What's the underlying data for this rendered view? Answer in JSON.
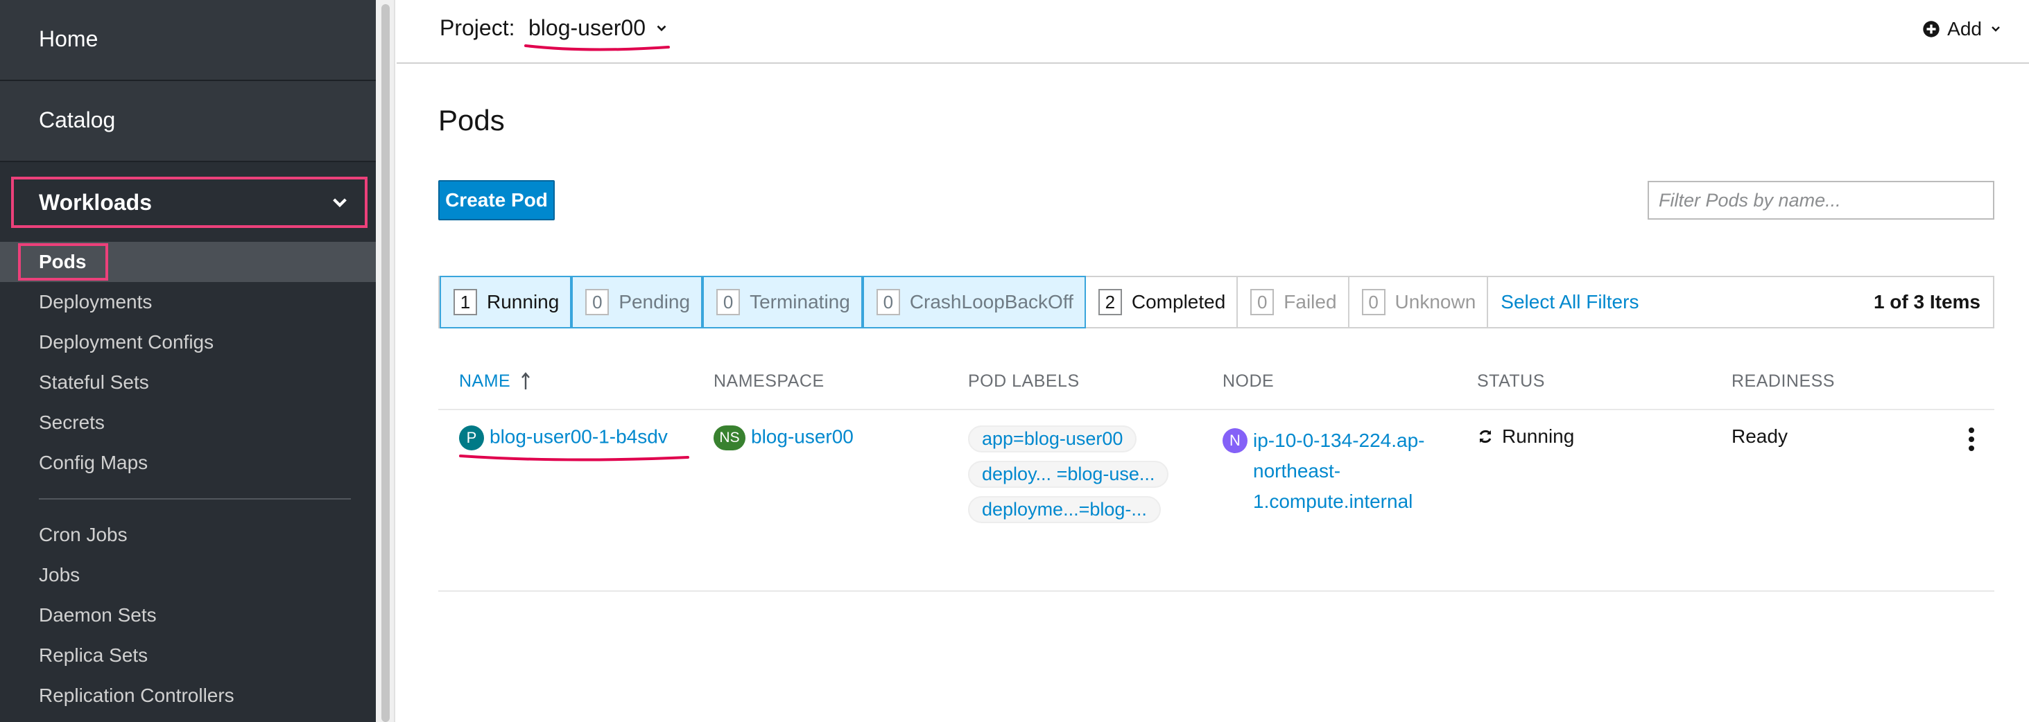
{
  "sidebar": {
    "top_items": [
      "Home",
      "Catalog"
    ],
    "section": "Workloads",
    "items": [
      {
        "label": "Pods"
      },
      {
        "label": "Deployments"
      },
      {
        "label": "Deployment Configs"
      },
      {
        "label": "Stateful Sets"
      },
      {
        "label": "Secrets"
      },
      {
        "label": "Config Maps"
      },
      {
        "label": "Cron Jobs"
      },
      {
        "label": "Jobs"
      },
      {
        "label": "Daemon Sets"
      },
      {
        "label": "Replica Sets"
      },
      {
        "label": "Replication Controllers"
      }
    ]
  },
  "header": {
    "project_label": "Project:",
    "project_value": "blog-user00",
    "add_label": "Add"
  },
  "page": {
    "title": "Pods",
    "create_button": "Create Pod",
    "filter_placeholder": "Filter Pods by name..."
  },
  "filters": {
    "items": [
      {
        "count": "1",
        "label": "Running"
      },
      {
        "count": "0",
        "label": "Pending"
      },
      {
        "count": "0",
        "label": "Terminating"
      },
      {
        "count": "0",
        "label": "CrashLoopBackOff"
      },
      {
        "count": "2",
        "label": "Completed"
      },
      {
        "count": "0",
        "label": "Failed"
      },
      {
        "count": "0",
        "label": "Unknown"
      }
    ],
    "select_all": "Select All Filters",
    "items_count": "1 of 3 Items"
  },
  "table": {
    "columns": [
      "NAME",
      "NAMESPACE",
      "POD LABELS",
      "NODE",
      "STATUS",
      "READINESS"
    ],
    "rows": [
      {
        "name_badge": "P",
        "name": "blog-user00-1-b4sdv",
        "namespace_badge": "NS",
        "namespace": "blog-user00",
        "labels": [
          "app=blog-user00",
          "deploy... =blog-use...",
          "deployme...=blog-..."
        ],
        "node_badge": "N",
        "node": "ip-10-0-134-224.ap-northeast-1.compute.internal",
        "node_lines": [
          "ip-10-0-134-224.ap-",
          "northeast-",
          "1.compute.internal"
        ],
        "status": "Running",
        "readiness": "Ready"
      }
    ]
  },
  "colors": {
    "sidebar_bg": "#292e34",
    "highlight": "#ec407a",
    "link": "#0088ce",
    "primary_button": "#0088ce",
    "filter_selected_bg": "#def3ff"
  },
  "icons": [
    "chevron-down-icon",
    "plus-circle-icon",
    "sort-asc-icon",
    "sync-icon",
    "kebab-icon"
  ]
}
